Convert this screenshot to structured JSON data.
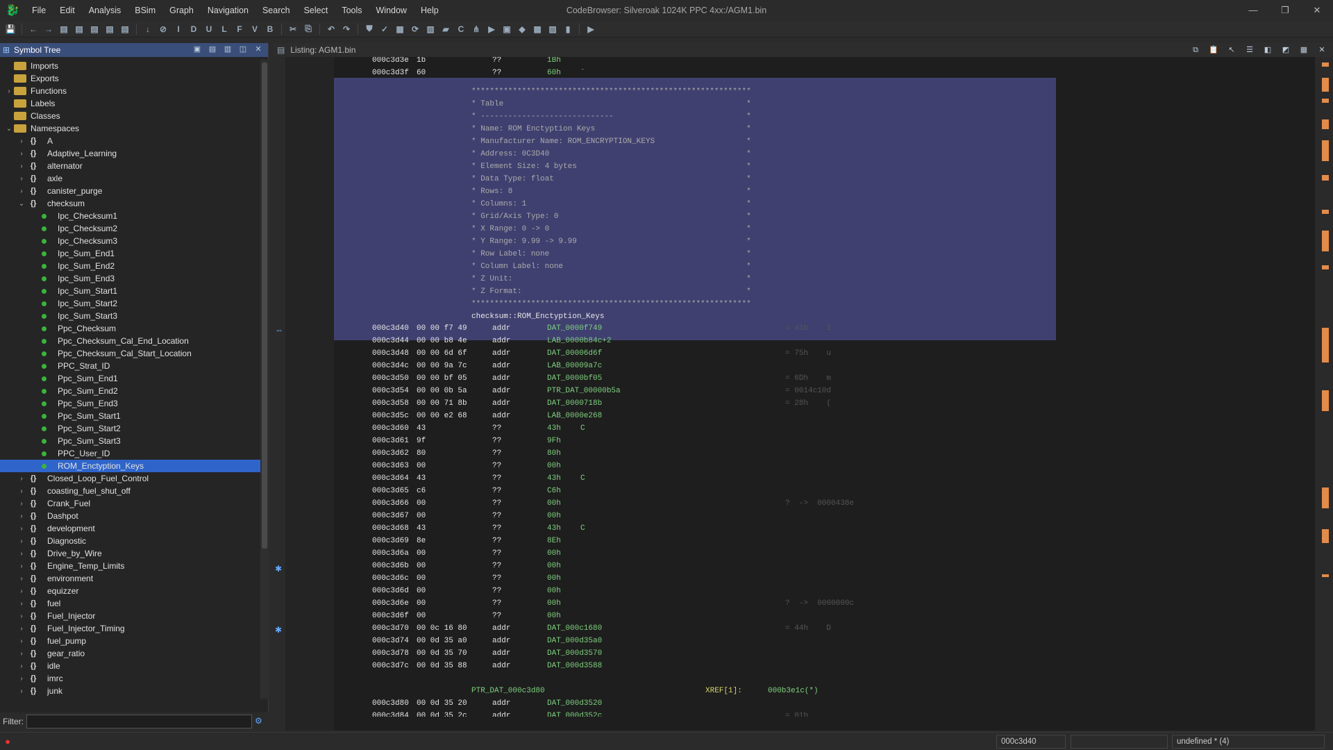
{
  "window": {
    "title": "CodeBrowser: Silveroak 1024K PPC 4xx:/AGM1.bin",
    "minimize": "—",
    "restore": "❐",
    "close": "✕"
  },
  "menus": [
    "File",
    "Edit",
    "Analysis",
    "BSim",
    "Graph",
    "Navigation",
    "Search",
    "Select",
    "Tools",
    "Window",
    "Help"
  ],
  "toolbar": {
    "icons": [
      "save-icon",
      "back-icon",
      "forward-icon",
      "list-icon",
      "list-icon",
      "list-icon",
      "list-icon",
      "list-icon",
      "down-arrow-icon",
      "stop-icon",
      "I",
      "D",
      "U",
      "L",
      "F",
      "V",
      "B",
      "cut-icon",
      "paste-icon",
      "undo-icon",
      "redo-icon",
      "bookmark-icon",
      "check-icon",
      "memory-icon",
      "refresh-icon",
      "table-icon",
      "folder-icon",
      "c-icon",
      "tree-icon",
      "run-icon",
      "data-icon",
      "diamond-icon",
      "grid-icon",
      "image-icon",
      "chart-icon",
      "play-icon"
    ]
  },
  "symbol_tree": {
    "title": "Symbol Tree",
    "filter_label": "Filter:",
    "filter_value": "",
    "items": [
      {
        "label": "Imports",
        "kind": "folder",
        "indent": 1,
        "expand": ""
      },
      {
        "label": "Exports",
        "kind": "folder",
        "indent": 1,
        "expand": ""
      },
      {
        "label": "Functions",
        "kind": "folder",
        "indent": 1,
        "expand": ">"
      },
      {
        "label": "Labels",
        "kind": "folder",
        "indent": 1,
        "expand": ""
      },
      {
        "label": "Classes",
        "kind": "folder",
        "indent": 1,
        "expand": ""
      },
      {
        "label": "Namespaces",
        "kind": "folder",
        "indent": 1,
        "expand": "v"
      },
      {
        "label": "A",
        "kind": "ns",
        "indent": 2,
        "expand": ">"
      },
      {
        "label": "Adaptive_Learning",
        "kind": "ns",
        "indent": 2,
        "expand": ">"
      },
      {
        "label": "alternator",
        "kind": "ns",
        "indent": 2,
        "expand": ">"
      },
      {
        "label": "axle",
        "kind": "ns",
        "indent": 2,
        "expand": ">"
      },
      {
        "label": "canister_purge",
        "kind": "ns",
        "indent": 2,
        "expand": ">"
      },
      {
        "label": "checksum",
        "kind": "ns",
        "indent": 2,
        "expand": "v"
      },
      {
        "label": "Ipc_Checksum1",
        "kind": "sym",
        "indent": 3,
        "expand": ""
      },
      {
        "label": "Ipc_Checksum2",
        "kind": "sym",
        "indent": 3,
        "expand": ""
      },
      {
        "label": "Ipc_Checksum3",
        "kind": "sym",
        "indent": 3,
        "expand": ""
      },
      {
        "label": "Ipc_Sum_End1",
        "kind": "sym",
        "indent": 3,
        "expand": ""
      },
      {
        "label": "Ipc_Sum_End2",
        "kind": "sym",
        "indent": 3,
        "expand": ""
      },
      {
        "label": "Ipc_Sum_End3",
        "kind": "sym",
        "indent": 3,
        "expand": ""
      },
      {
        "label": "Ipc_Sum_Start1",
        "kind": "sym",
        "indent": 3,
        "expand": ""
      },
      {
        "label": "Ipc_Sum_Start2",
        "kind": "sym",
        "indent": 3,
        "expand": ""
      },
      {
        "label": "Ipc_Sum_Start3",
        "kind": "sym",
        "indent": 3,
        "expand": ""
      },
      {
        "label": "Ppc_Checksum",
        "kind": "sym",
        "indent": 3,
        "expand": ""
      },
      {
        "label": "Ppc_Checksum_Cal_End_Location",
        "kind": "sym",
        "indent": 3,
        "expand": ""
      },
      {
        "label": "Ppc_Checksum_Cal_Start_Location",
        "kind": "sym",
        "indent": 3,
        "expand": ""
      },
      {
        "label": "PPC_Strat_ID",
        "kind": "sym",
        "indent": 3,
        "expand": ""
      },
      {
        "label": "Ppc_Sum_End1",
        "kind": "sym",
        "indent": 3,
        "expand": ""
      },
      {
        "label": "Ppc_Sum_End2",
        "kind": "sym",
        "indent": 3,
        "expand": ""
      },
      {
        "label": "Ppc_Sum_End3",
        "kind": "sym",
        "indent": 3,
        "expand": ""
      },
      {
        "label": "Ppc_Sum_Start1",
        "kind": "sym",
        "indent": 3,
        "expand": ""
      },
      {
        "label": "Ppc_Sum_Start2",
        "kind": "sym",
        "indent": 3,
        "expand": ""
      },
      {
        "label": "Ppc_Sum_Start3",
        "kind": "sym",
        "indent": 3,
        "expand": ""
      },
      {
        "label": "PPC_User_ID",
        "kind": "sym",
        "indent": 3,
        "expand": ""
      },
      {
        "label": "ROM_Enctyption_Keys",
        "kind": "sym",
        "indent": 3,
        "expand": "",
        "selected": true
      },
      {
        "label": "Closed_Loop_Fuel_Control",
        "kind": "ns",
        "indent": 2,
        "expand": ">"
      },
      {
        "label": "coasting_fuel_shut_off",
        "kind": "ns",
        "indent": 2,
        "expand": ">"
      },
      {
        "label": "Crank_Fuel",
        "kind": "ns",
        "indent": 2,
        "expand": ">"
      },
      {
        "label": "Dashpot",
        "kind": "ns",
        "indent": 2,
        "expand": ">"
      },
      {
        "label": "development",
        "kind": "ns",
        "indent": 2,
        "expand": ">"
      },
      {
        "label": "Diagnostic",
        "kind": "ns",
        "indent": 2,
        "expand": ">"
      },
      {
        "label": "Drive_by_Wire",
        "kind": "ns",
        "indent": 2,
        "expand": ">"
      },
      {
        "label": "Engine_Temp_Limits",
        "kind": "ns",
        "indent": 2,
        "expand": ">"
      },
      {
        "label": "environment",
        "kind": "ns",
        "indent": 2,
        "expand": ">"
      },
      {
        "label": "equizzer",
        "kind": "ns",
        "indent": 2,
        "expand": ">"
      },
      {
        "label": "fuel",
        "kind": "ns",
        "indent": 2,
        "expand": ">"
      },
      {
        "label": "Fuel_Injector",
        "kind": "ns",
        "indent": 2,
        "expand": ">"
      },
      {
        "label": "Fuel_Injector_Timing",
        "kind": "ns",
        "indent": 2,
        "expand": ">"
      },
      {
        "label": "fuel_pump",
        "kind": "ns",
        "indent": 2,
        "expand": ">"
      },
      {
        "label": "gear_ratio",
        "kind": "ns",
        "indent": 2,
        "expand": ">"
      },
      {
        "label": "idle",
        "kind": "ns",
        "indent": 2,
        "expand": ">"
      },
      {
        "label": "imrc",
        "kind": "ns",
        "indent": 2,
        "expand": ">"
      },
      {
        "label": "junk",
        "kind": "ns",
        "indent": 2,
        "expand": ">"
      }
    ]
  },
  "listing": {
    "title": "Listing:  AGM1.bin",
    "pre_lines": [
      {
        "addr": "000c3d3e",
        "bytes": "1b",
        "mnem": "??",
        "oper": "1Bh",
        "chr": ""
      },
      {
        "addr": "000c3d3f",
        "bytes": "60",
        "mnem": "??",
        "oper": "60h",
        "chr": "`"
      }
    ],
    "plate": [
      "*************************************************************",
      "* Table                                                     *",
      "* -----------------------------                             *",
      "* Name: ROM Enctyption Keys                                 *",
      "* Manufacturer Name: ROM_ENCRYPTION_KEYS                    *",
      "* Address: 0C3D40                                           *",
      "* Element Size: 4 bytes                                     *",
      "* Data Type: float                                          *",
      "* Rows: 8                                                   *",
      "* Columns: 1                                                *",
      "* Grid/Axis Type: 0                                         *",
      "* X Range: 0 -> 0                                           *",
      "* Y Range: 9.99 -> 9.99                                     *",
      "* Row Label: none                                           *",
      "* Column Label: none                                        *",
      "* Z Unit:                                                   *",
      "* Z Format:                                                 *",
      "*************************************************************"
    ],
    "label": "checksum::ROM_Enctyption_Keys",
    "lines": [
      {
        "addr": "000c3d40",
        "bytes": "00 00 f7 49",
        "mnem": "addr",
        "oper": "DAT_0000f749",
        "chr": "",
        "cmt": "= 41h    I"
      },
      {
        "addr": "000c3d44",
        "bytes": "00 00 b8 4e",
        "mnem": "addr",
        "oper": "LAB_0000b84c+2",
        "chr": "",
        "cmt": ""
      },
      {
        "addr": "000c3d48",
        "bytes": "00 00 6d 6f",
        "mnem": "addr",
        "oper": "DAT_00006d6f",
        "chr": "",
        "cmt": "= 75h    u"
      },
      {
        "addr": "000c3d4c",
        "bytes": "00 00 9a 7c",
        "mnem": "addr",
        "oper": "LAB_00009a7c",
        "chr": "",
        "cmt": ""
      },
      {
        "addr": "000c3d50",
        "bytes": "00 00 bf 05",
        "mnem": "addr",
        "oper": "DAT_0000bf05",
        "chr": "",
        "cmt": "= 6Dh    m"
      },
      {
        "addr": "000c3d54",
        "bytes": "00 00 0b 5a",
        "mnem": "addr",
        "oper": "PTR_DAT_00000b5a",
        "chr": "",
        "cmt": "= 0014c10d"
      },
      {
        "addr": "000c3d58",
        "bytes": "00 00 71 8b",
        "mnem": "addr",
        "oper": "DAT_0000718b",
        "chr": "",
        "cmt": "= 28h    ("
      },
      {
        "addr": "000c3d5c",
        "bytes": "00 00 e2 68",
        "mnem": "addr",
        "oper": "LAB_0000e268",
        "chr": "",
        "cmt": ""
      },
      {
        "addr": "000c3d60",
        "bytes": "43",
        "mnem": "??",
        "oper": "43h",
        "chr": "C",
        "cmt": ""
      },
      {
        "addr": "000c3d61",
        "bytes": "9f",
        "mnem": "??",
        "oper": "9Fh",
        "chr": "",
        "cmt": ""
      },
      {
        "addr": "000c3d62",
        "bytes": "80",
        "mnem": "??",
        "oper": "80h",
        "chr": "",
        "cmt": ""
      },
      {
        "addr": "000c3d63",
        "bytes": "00",
        "mnem": "??",
        "oper": "00h",
        "chr": "",
        "cmt": ""
      },
      {
        "addr": "000c3d64",
        "bytes": "43",
        "mnem": "??",
        "oper": "43h",
        "chr": "C",
        "cmt": ""
      },
      {
        "addr": "000c3d65",
        "bytes": "c6",
        "mnem": "??",
        "oper": "C6h",
        "chr": "",
        "cmt": ""
      },
      {
        "addr": "000c3d66",
        "bytes": "00",
        "mnem": "??",
        "oper": "00h",
        "chr": "",
        "cmt": "?  ->  0000438e"
      },
      {
        "addr": "000c3d67",
        "bytes": "00",
        "mnem": "??",
        "oper": "00h",
        "chr": "",
        "cmt": ""
      },
      {
        "addr": "000c3d68",
        "bytes": "43",
        "mnem": "??",
        "oper": "43h",
        "chr": "C",
        "cmt": ""
      },
      {
        "addr": "000c3d69",
        "bytes": "8e",
        "mnem": "??",
        "oper": "8Eh",
        "chr": "",
        "cmt": ""
      },
      {
        "addr": "000c3d6a",
        "bytes": "00",
        "mnem": "??",
        "oper": "00h",
        "chr": "",
        "cmt": ""
      },
      {
        "addr": "000c3d6b",
        "bytes": "00",
        "mnem": "??",
        "oper": "00h",
        "chr": "",
        "cmt": ""
      },
      {
        "addr": "000c3d6c",
        "bytes": "00",
        "mnem": "??",
        "oper": "00h",
        "chr": "",
        "cmt": ""
      },
      {
        "addr": "000c3d6d",
        "bytes": "00",
        "mnem": "??",
        "oper": "00h",
        "chr": "",
        "cmt": ""
      },
      {
        "addr": "000c3d6e",
        "bytes": "00",
        "mnem": "??",
        "oper": "00h",
        "chr": "",
        "cmt": "?  ->  0000000c"
      },
      {
        "addr": "000c3d6f",
        "bytes": "00",
        "mnem": "??",
        "oper": "00h",
        "chr": "",
        "cmt": ""
      },
      {
        "addr": "000c3d70",
        "bytes": "00 0c 16 80",
        "mnem": "addr",
        "oper": "DAT_000c1680",
        "chr": "",
        "cmt": "= 44h    D"
      },
      {
        "addr": "000c3d74",
        "bytes": "00 0d 35 a0",
        "mnem": "addr",
        "oper": "DAT_000d35a0",
        "chr": "",
        "cmt": ""
      },
      {
        "addr": "000c3d78",
        "bytes": "00 0d 35 70",
        "mnem": "addr",
        "oper": "DAT_000d3570",
        "chr": "",
        "cmt": ""
      },
      {
        "addr": "000c3d7c",
        "bytes": "00 0d 35 88",
        "mnem": "addr",
        "oper": "DAT_000d3588",
        "chr": "",
        "cmt": ""
      }
    ],
    "ptr_label": "PTR_DAT_000c3d80",
    "xref_label": "XREF[1]:",
    "xref_value": "000b3e1c(*)",
    "post_lines": [
      {
        "addr": "000c3d80",
        "bytes": "00 0d 35 20",
        "mnem": "addr",
        "oper": "DAT_000d3520",
        "chr": "",
        "cmt": ""
      },
      {
        "addr": "000c3d84",
        "bytes": "00 0d 35 2c",
        "mnem": "addr",
        "oper": "DAT_000d352c",
        "chr": "",
        "cmt": "= 01h"
      }
    ]
  },
  "status": {
    "address": "000c3d40",
    "type": "undefined * (4)"
  },
  "colors": {
    "selection": "#2f65ca",
    "plate_bg": "#404070",
    "operand": "#7fd07f"
  }
}
